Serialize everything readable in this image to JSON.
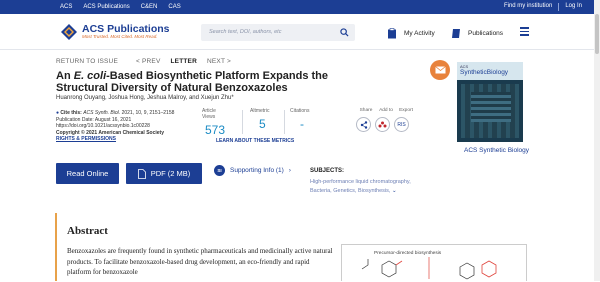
{
  "topbar": {
    "links": [
      "ACS",
      "ACS Publications",
      "C&EN",
      "CAS"
    ],
    "find_institution": "Find my institution",
    "login": "Log In"
  },
  "header": {
    "logo_title": "ACS Publications",
    "logo_tagline": "Most Trusted. Most Cited. Most Read.",
    "search_placeholder": "Search text, DOI, authors, etc",
    "my_activity": "My Activity",
    "publications": "Publications"
  },
  "nav": {
    "return": "RETURN TO ISSUE",
    "prev": "< PREV",
    "letter": "LETTER",
    "next": "NEXT >"
  },
  "article": {
    "title_pre": "An ",
    "title_italic": "E. coli",
    "title_post": "-Based Biosynthetic Platform Expands the Structural Diversity of Natural Benzoxazoles",
    "authors": "Huanrong Ouyang, Joshua Hong, Jeshua Malroy, and Xuejun Zhu*",
    "cite_label": "Cite this:",
    "cite_journal": "ACS Synth. Biol.",
    "cite_ref": "2021, 10, 9, 2151–2158",
    "pub_date": "Publication Date: August 16, 2021",
    "doi": "https://doi.org/10.1021/acssynbio.1c00228",
    "copyright": "Copyright © 2021 American Chemical Society",
    "rights": "RIGHTS & PERMISSIONS"
  },
  "metrics": {
    "views_label": "Article Views",
    "views": "573",
    "altmetric_label": "Altmetric",
    "altmetric": "5",
    "citations_label": "Citations",
    "citations": "-",
    "learn_more": "LEARN ABOUT THESE METRICS"
  },
  "share": {
    "share_label": "Share",
    "add_label": "Add to",
    "export_label": "Export",
    "export_icon_text": "RIS"
  },
  "buttons": {
    "read_online": "Read Online",
    "pdf": "PDF (2 MB)",
    "supporting": "Supporting Info (1)",
    "si_badge": "SI"
  },
  "subjects": {
    "heading": "SUBJECTS:",
    "items": "High-performance liquid chromatography, Bacteria, Genetics, Biosynthesis,"
  },
  "journal": {
    "name": "ACS Synthetic Biology",
    "cover_brand": "ACS",
    "cover_title": "SyntheticBiology"
  },
  "abstract": {
    "heading": "Abstract",
    "text": "Benzoxazoles are frequently found in synthetic pharmaceuticals and medicinally active natural products. To facilitate benzoxazole-based drug development, an eco-friendly and rapid platform for benzoxazole",
    "toc_caption": "Precursor-directed biosynthesis"
  },
  "colors": {
    "brand_blue": "#1c3e94",
    "metric_blue": "#1b8bc4",
    "accent_orange": "#e8823b"
  }
}
